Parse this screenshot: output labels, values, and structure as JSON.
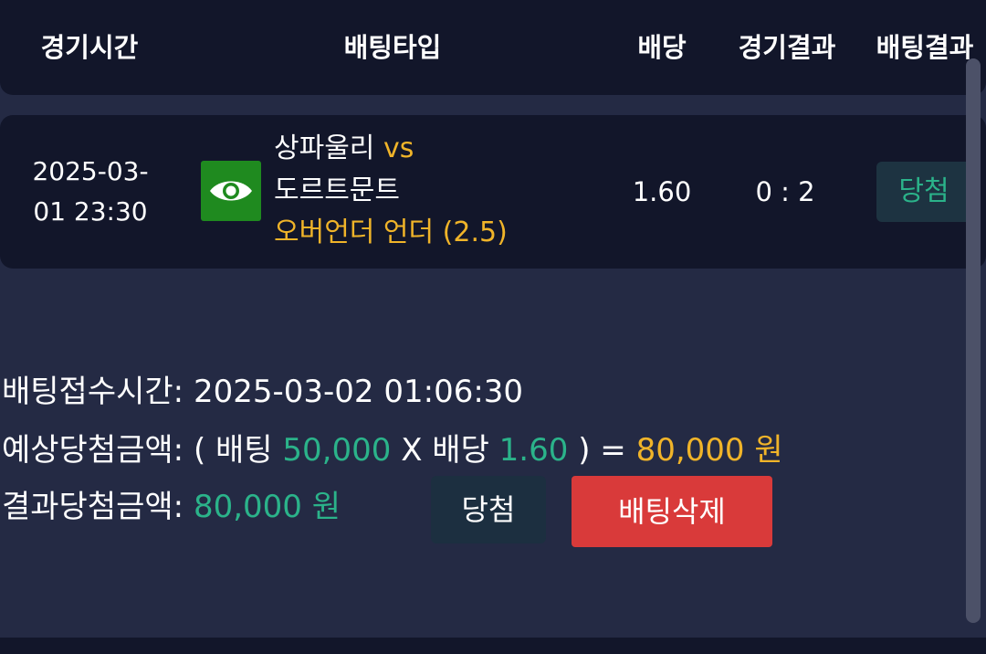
{
  "header": {
    "time": "경기시간",
    "bet_type": "배팅타입",
    "odds": "배당",
    "game_result": "경기결과",
    "bet_result": "배팅결과"
  },
  "bet": {
    "time_line1": "2025-03-",
    "time_line2": "01 23:30",
    "icon": "eye-icon",
    "home_team": "상파울리",
    "vs": "vs",
    "away_team": "도르트문트",
    "bet_type": "오버언더 언더 (2.5)",
    "odds": "1.60",
    "score": "0 : 2",
    "result": "당첨"
  },
  "summary": {
    "received_label": "배팅접수시간:",
    "received_value": "2025-03-02 01:06:30",
    "expected_label": "예상당첨금액:",
    "open_paren": "(",
    "bet_word": "배팅",
    "bet_amount": "50,000",
    "times": "X",
    "odds_word": "배당",
    "odds_value": "1.60",
    "close_eq": ") =",
    "expected_amount": "80,000 원",
    "result_label": "결과당첨금액:",
    "result_amount": "80,000 원",
    "status_button": "당첨",
    "delete_button": "배팅삭제"
  },
  "colors": {
    "background": "#242a44",
    "card": "#12162a",
    "gold": "#f0b429",
    "green": "#2bb38a",
    "delete": "#d93a3a",
    "icon_bg": "#1f8a1f"
  }
}
